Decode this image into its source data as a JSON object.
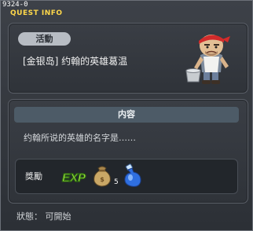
{
  "window": {
    "id": "9324-0",
    "title": "QUEST INFO"
  },
  "quest": {
    "tag": "活動",
    "name": "[金银岛] 约翰的英雄葛温"
  },
  "content": {
    "header": "内容",
    "text": "约翰所说的英雄的名字是……"
  },
  "reward": {
    "label": "獎勵",
    "items": [
      {
        "icon": "exp-icon",
        "text": "EXP"
      },
      {
        "icon": "money-bag-icon",
        "qty": "5"
      },
      {
        "icon": "potion-icon"
      }
    ]
  },
  "status": {
    "text": "狀態： 可開始"
  },
  "colors": {
    "title": "#ffd84a",
    "exp_green": "#9ae63a",
    "panel_bg": "#34383e"
  }
}
